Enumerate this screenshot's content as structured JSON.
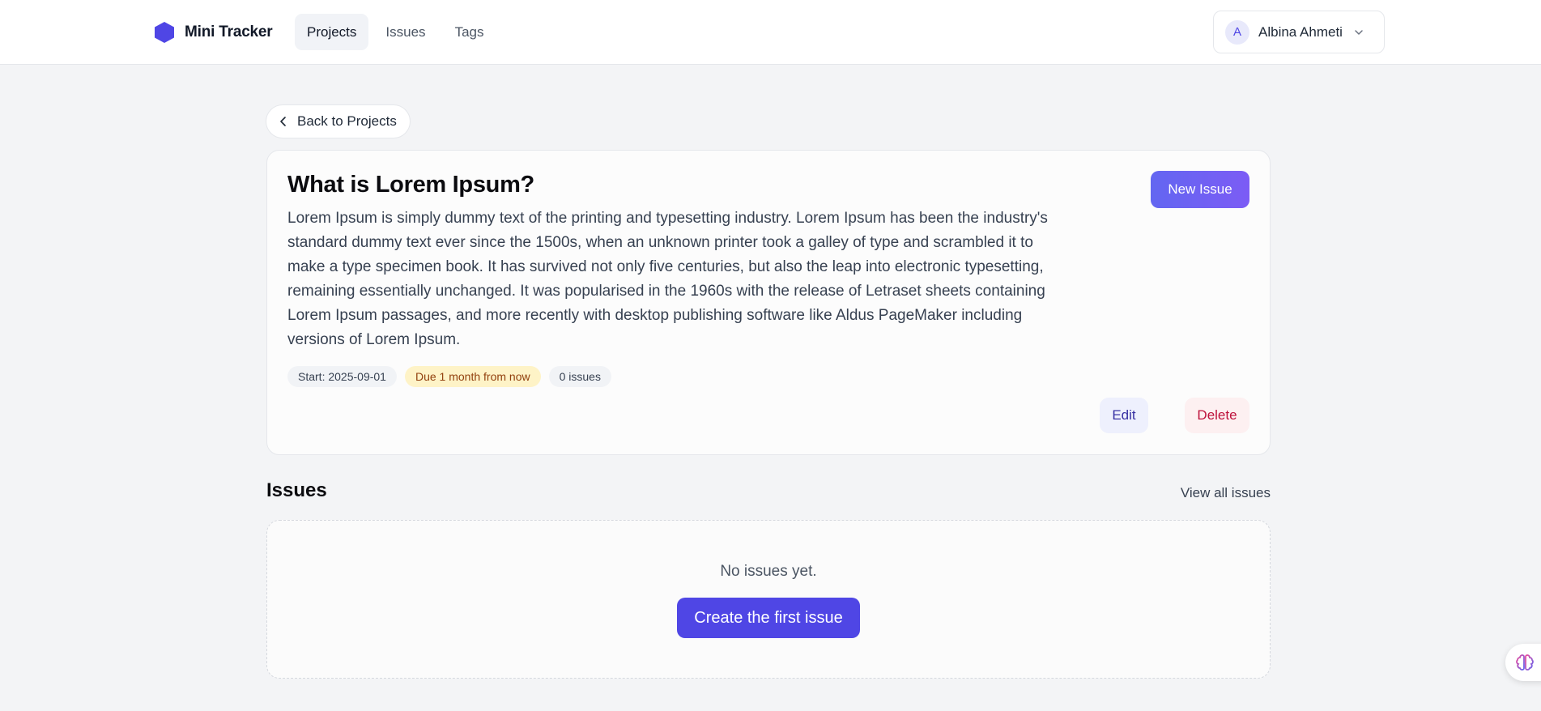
{
  "app": {
    "name": "Mini Tracker",
    "brand_color": "#4f46e5"
  },
  "nav": {
    "items": [
      {
        "label": "Projects",
        "active": true
      },
      {
        "label": "Issues",
        "active": false
      },
      {
        "label": "Tags",
        "active": false
      }
    ]
  },
  "user": {
    "initial": "A",
    "name": "Albina Ahmeti",
    "menu_icon": "chevron-down-icon"
  },
  "back": {
    "label": "Back to Projects",
    "icon": "chevron-left-icon"
  },
  "project": {
    "title": "What is Lorem Ipsum?",
    "description": "Lorem Ipsum is simply dummy text of the printing and typesetting industry. Lorem Ipsum has been the industry's standard dummy text ever since the 1500s, when an unknown printer took a galley of type and scrambled it to make a type specimen book. It has survived not only five centuries, but also the leap into electronic typesetting, remaining essentially unchanged. It was popularised in the 1960s with the release of Letraset sheets containing Lorem Ipsum passages, and more recently with desktop publishing software like Aldus PageMaker including versions of Lorem Ipsum.",
    "start_chip": "Start: 2025-09-01",
    "due_chip": "Due 1 month from now",
    "issues_chip": "0 issues",
    "new_issue_label": "New Issue",
    "edit_label": "Edit",
    "delete_label": "Delete"
  },
  "issues": {
    "heading": "Issues",
    "view_all_label": "View all issues",
    "empty_text": "No issues yet.",
    "create_first_label": "Create the first issue"
  },
  "colors": {
    "accent": "#4f46e5",
    "due_bg": "#fef3c7",
    "delete_text": "#be123c"
  },
  "floating_widget": {
    "icon": "brain-icon"
  }
}
